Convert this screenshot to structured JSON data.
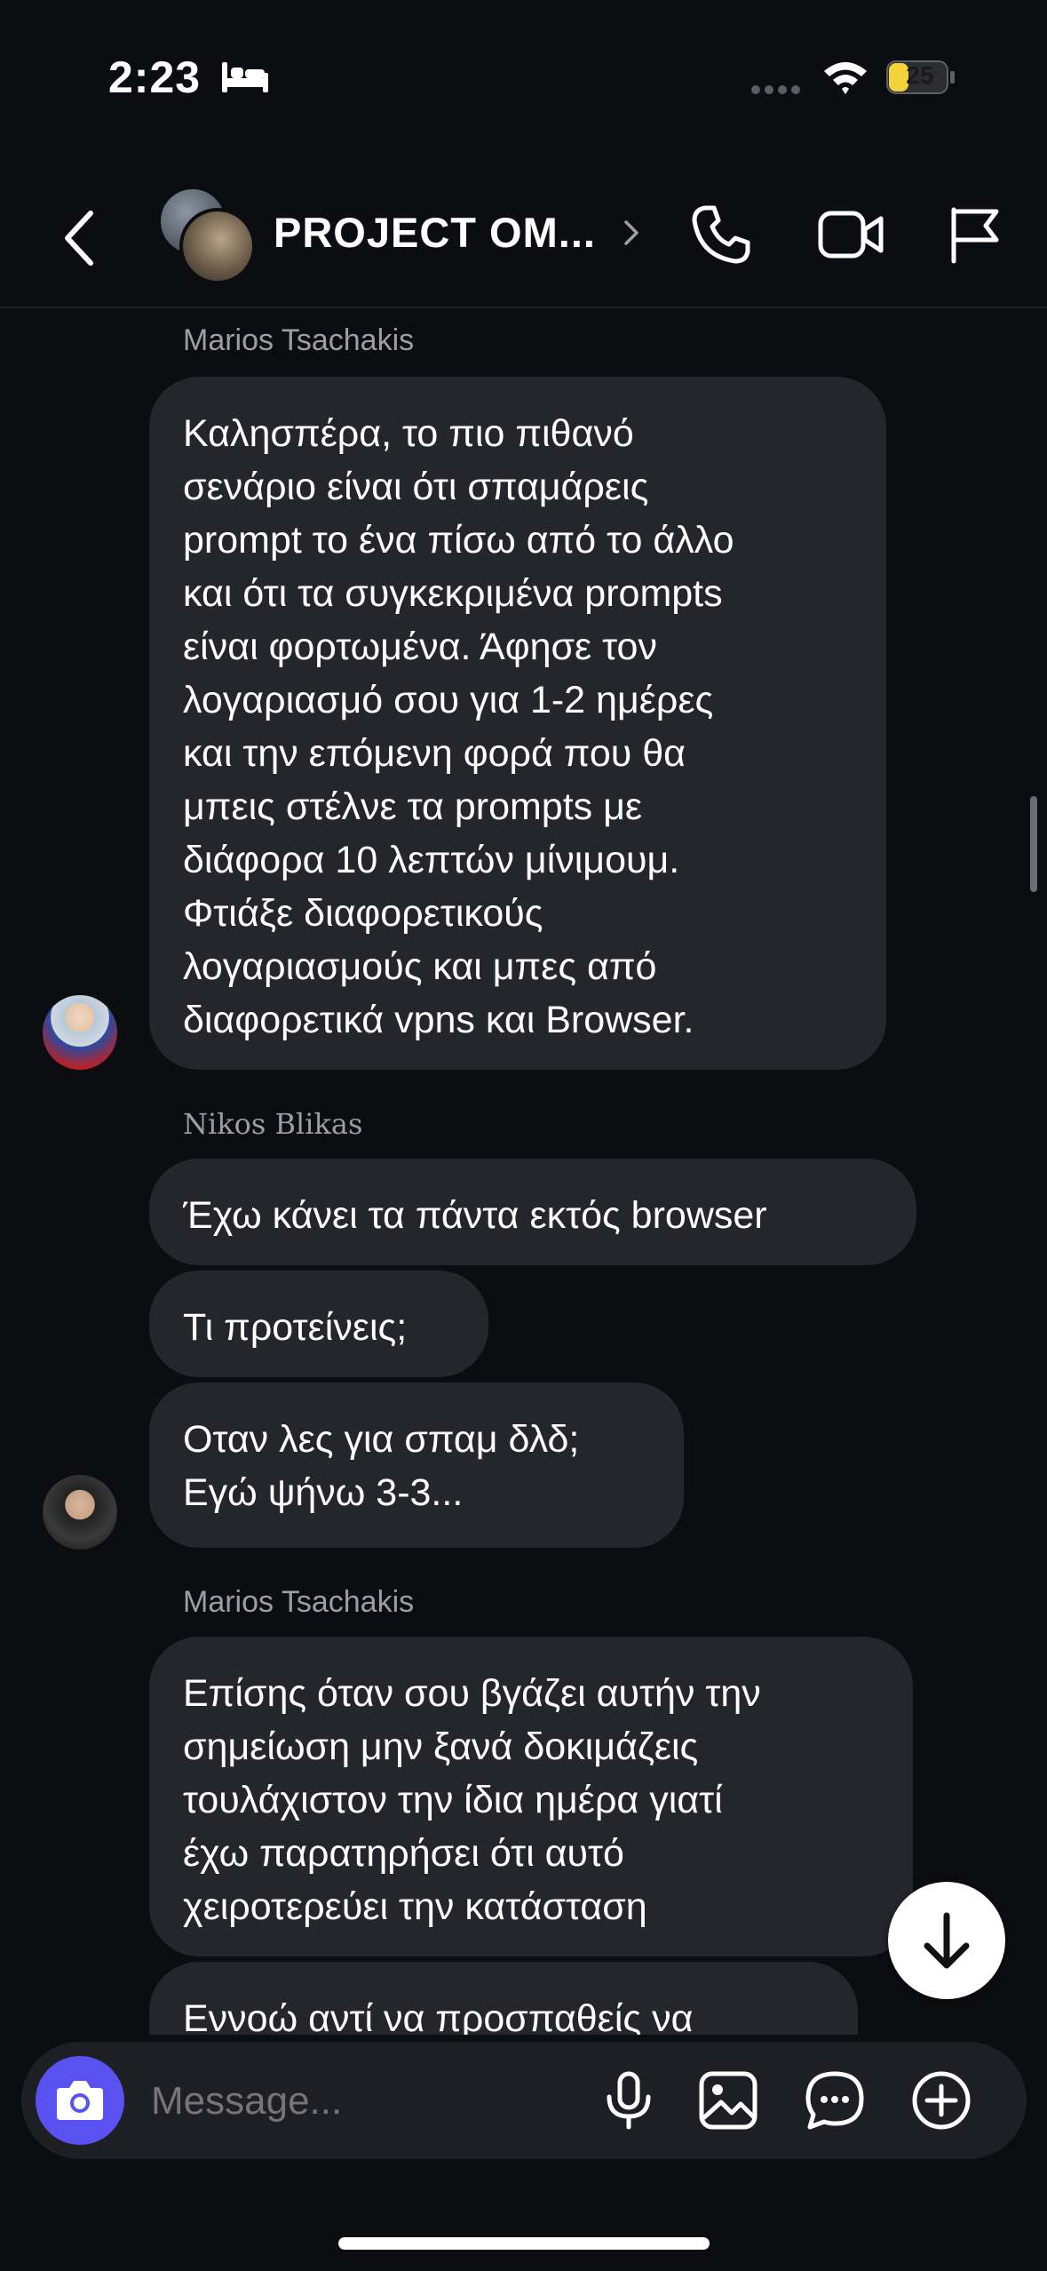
{
  "status_bar": {
    "time": "2:23",
    "battery": "25"
  },
  "header": {
    "title": "PROJECT OM..."
  },
  "messages": [
    {
      "sender": "Marios Tsachakis",
      "bubbles": [
        [
          "Καλησπέρα, το πιο πιθανό",
          "σενάριο είναι ότι σπαμάρεις",
          "prompt το ένα πίσω από το άλλο",
          "και ότι τα συγκεκριμένα prompts",
          "είναι φορτωμένα. Άφησε τον",
          "λογαριασμό σου για 1-2 ημέρες",
          "και την επόμενη φορά που θα",
          "μπεις στέλνε τα prompts με",
          "διάφορα 10 λεπτών μίνιμουμ.",
          "Φτιάξε διαφορετικούς",
          "λογαριασμούς και μπες από",
          "διαφορετικά vpns και Browser."
        ]
      ]
    },
    {
      "sender": "Nikos Blikas",
      "bubbles": [
        [
          "Έχω κάνει τα πάντα εκτός browser"
        ],
        [
          "Τι προτείνεις;"
        ],
        [
          "Οταν λες για σπαμ δλδ;",
          "Εγώ ψήνω 3-3..."
        ]
      ]
    },
    {
      "sender": "Marios Tsachakis",
      "bubbles": [
        [
          "Επίσης όταν σου βγάζει αυτήν την",
          "σημείωση μην ξανά δοκιμάζεις",
          "τουλάχιστον την ίδια ημέρα γιατί",
          "έχω παρατηρήσει ότι αυτό",
          "χειροτερεύει την κατάσταση"
        ],
        [
          "Εννοώ αντί να προσπαθείς να"
        ]
      ]
    }
  ],
  "composer": {
    "placeholder": "Message..."
  },
  "icons": {
    "back": "chevron-left-icon",
    "call": "phone-icon",
    "video": "video-camera-icon",
    "flag": "flag-icon",
    "camera": "camera-icon",
    "mic": "microphone-icon",
    "gallery": "image-icon",
    "sticker": "chat-bubble-icon",
    "plus": "plus-circle-icon",
    "scroll_down": "arrow-down-icon"
  },
  "colors": {
    "background": "#0c0d10",
    "bubble": "#25262b",
    "accent": "#5a52f0",
    "battery_fill": "#f4d33a"
  }
}
